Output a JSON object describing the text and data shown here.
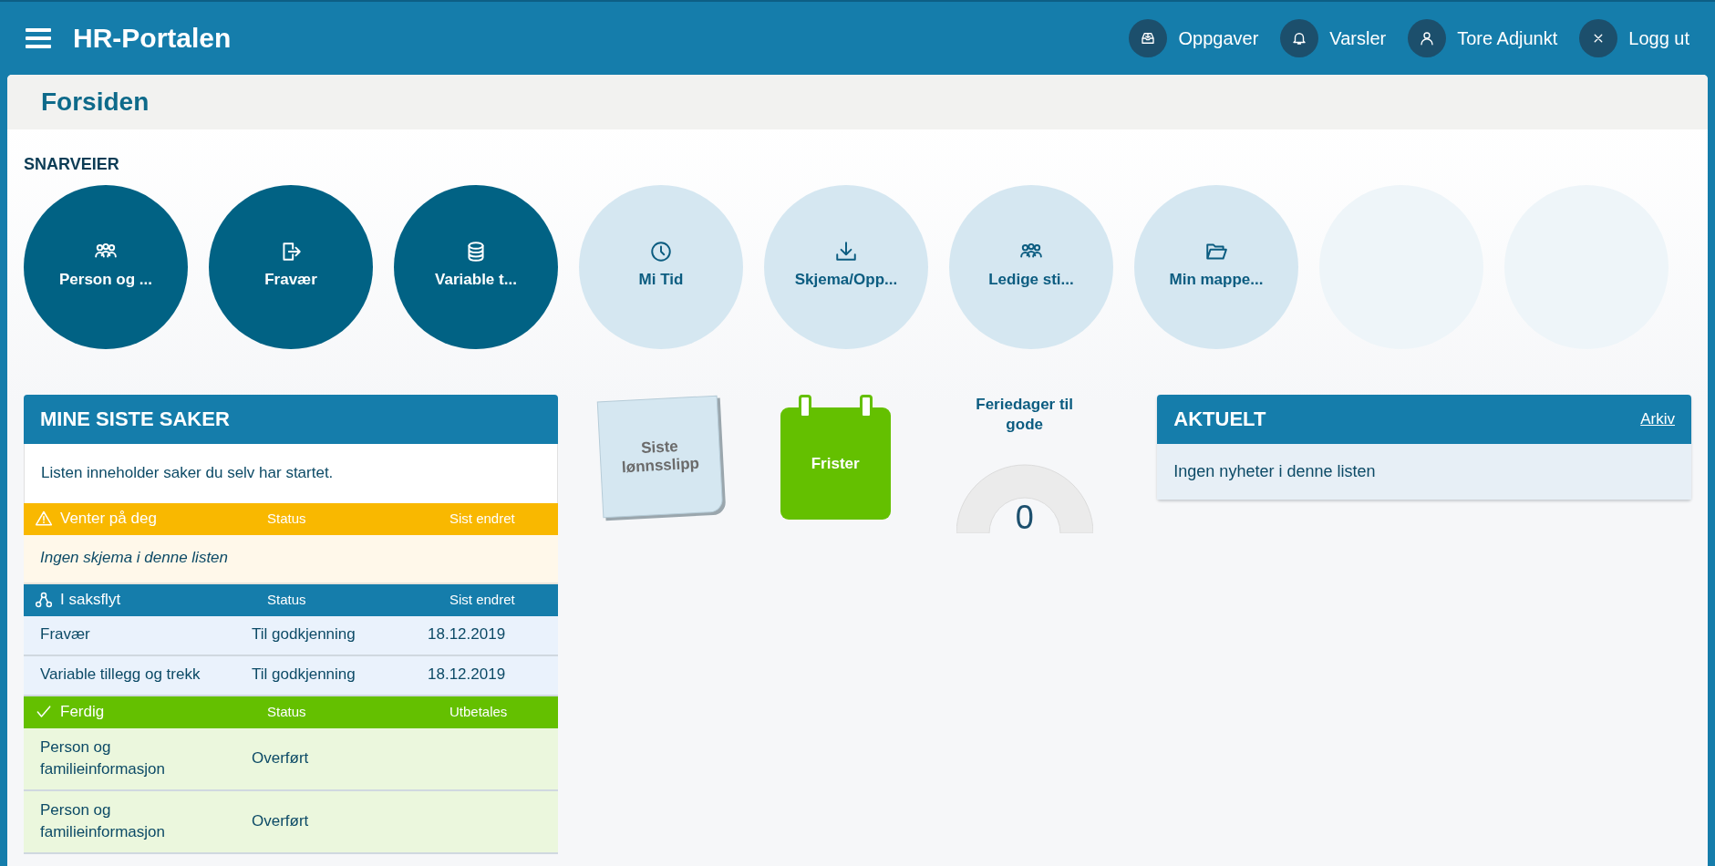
{
  "header": {
    "title": "HR-Portalen",
    "actions": [
      {
        "label": "Oppgaver"
      },
      {
        "label": "Varsler"
      },
      {
        "label": "Tore Adjunkt"
      },
      {
        "label": "Logg ut"
      }
    ]
  },
  "page_title": "Forsiden",
  "shortcuts": {
    "heading": "SNARVEIER",
    "items": [
      {
        "kind": "dark",
        "label": "Person og ..."
      },
      {
        "kind": "dark",
        "label": "Fravær"
      },
      {
        "kind": "dark",
        "label": "Variable t..."
      },
      {
        "kind": "light",
        "label": "Mi Tid"
      },
      {
        "kind": "light",
        "label": "Skjema/Opp..."
      },
      {
        "kind": "light",
        "label": "Ledige sti..."
      },
      {
        "kind": "light",
        "label": "Min mappe..."
      },
      {
        "kind": "empty"
      },
      {
        "kind": "empty"
      }
    ]
  },
  "cases": {
    "title": "MINE SISTE SAKER",
    "intro": "Listen inneholder saker du selv har startet.",
    "sections": [
      {
        "kind": "waiting",
        "title": "Venter på deg",
        "columns": [
          "Status",
          "Sist endret"
        ],
        "empty": "Ingen skjema i denne listen"
      },
      {
        "kind": "flow",
        "title": "I saksflyt",
        "columns": [
          "Status",
          "Sist endret"
        ],
        "rows": [
          {
            "name": "Fravær",
            "status": "Til godkjenning",
            "date": "18.12.2019"
          },
          {
            "name": "Variable tillegg og trekk",
            "status": "Til godkjenning",
            "date": "18.12.2019"
          }
        ]
      },
      {
        "kind": "done",
        "title": "Ferdig",
        "columns": [
          "Status",
          "Utbetales"
        ],
        "rows": [
          {
            "name": "Person og familieinformasjon",
            "status": "Overført"
          },
          {
            "name": "Person og familieinformasjon",
            "status": "Overført"
          }
        ]
      }
    ]
  },
  "widgets": {
    "payslip": "Siste lønnsslipp",
    "deadlines": "Frister",
    "vacation": {
      "label": "Feriedager til gode",
      "value": "0"
    }
  },
  "news": {
    "title": "AKTUELT",
    "link": "Arkiv",
    "empty": "Ingen nyheter i denne listen"
  }
}
